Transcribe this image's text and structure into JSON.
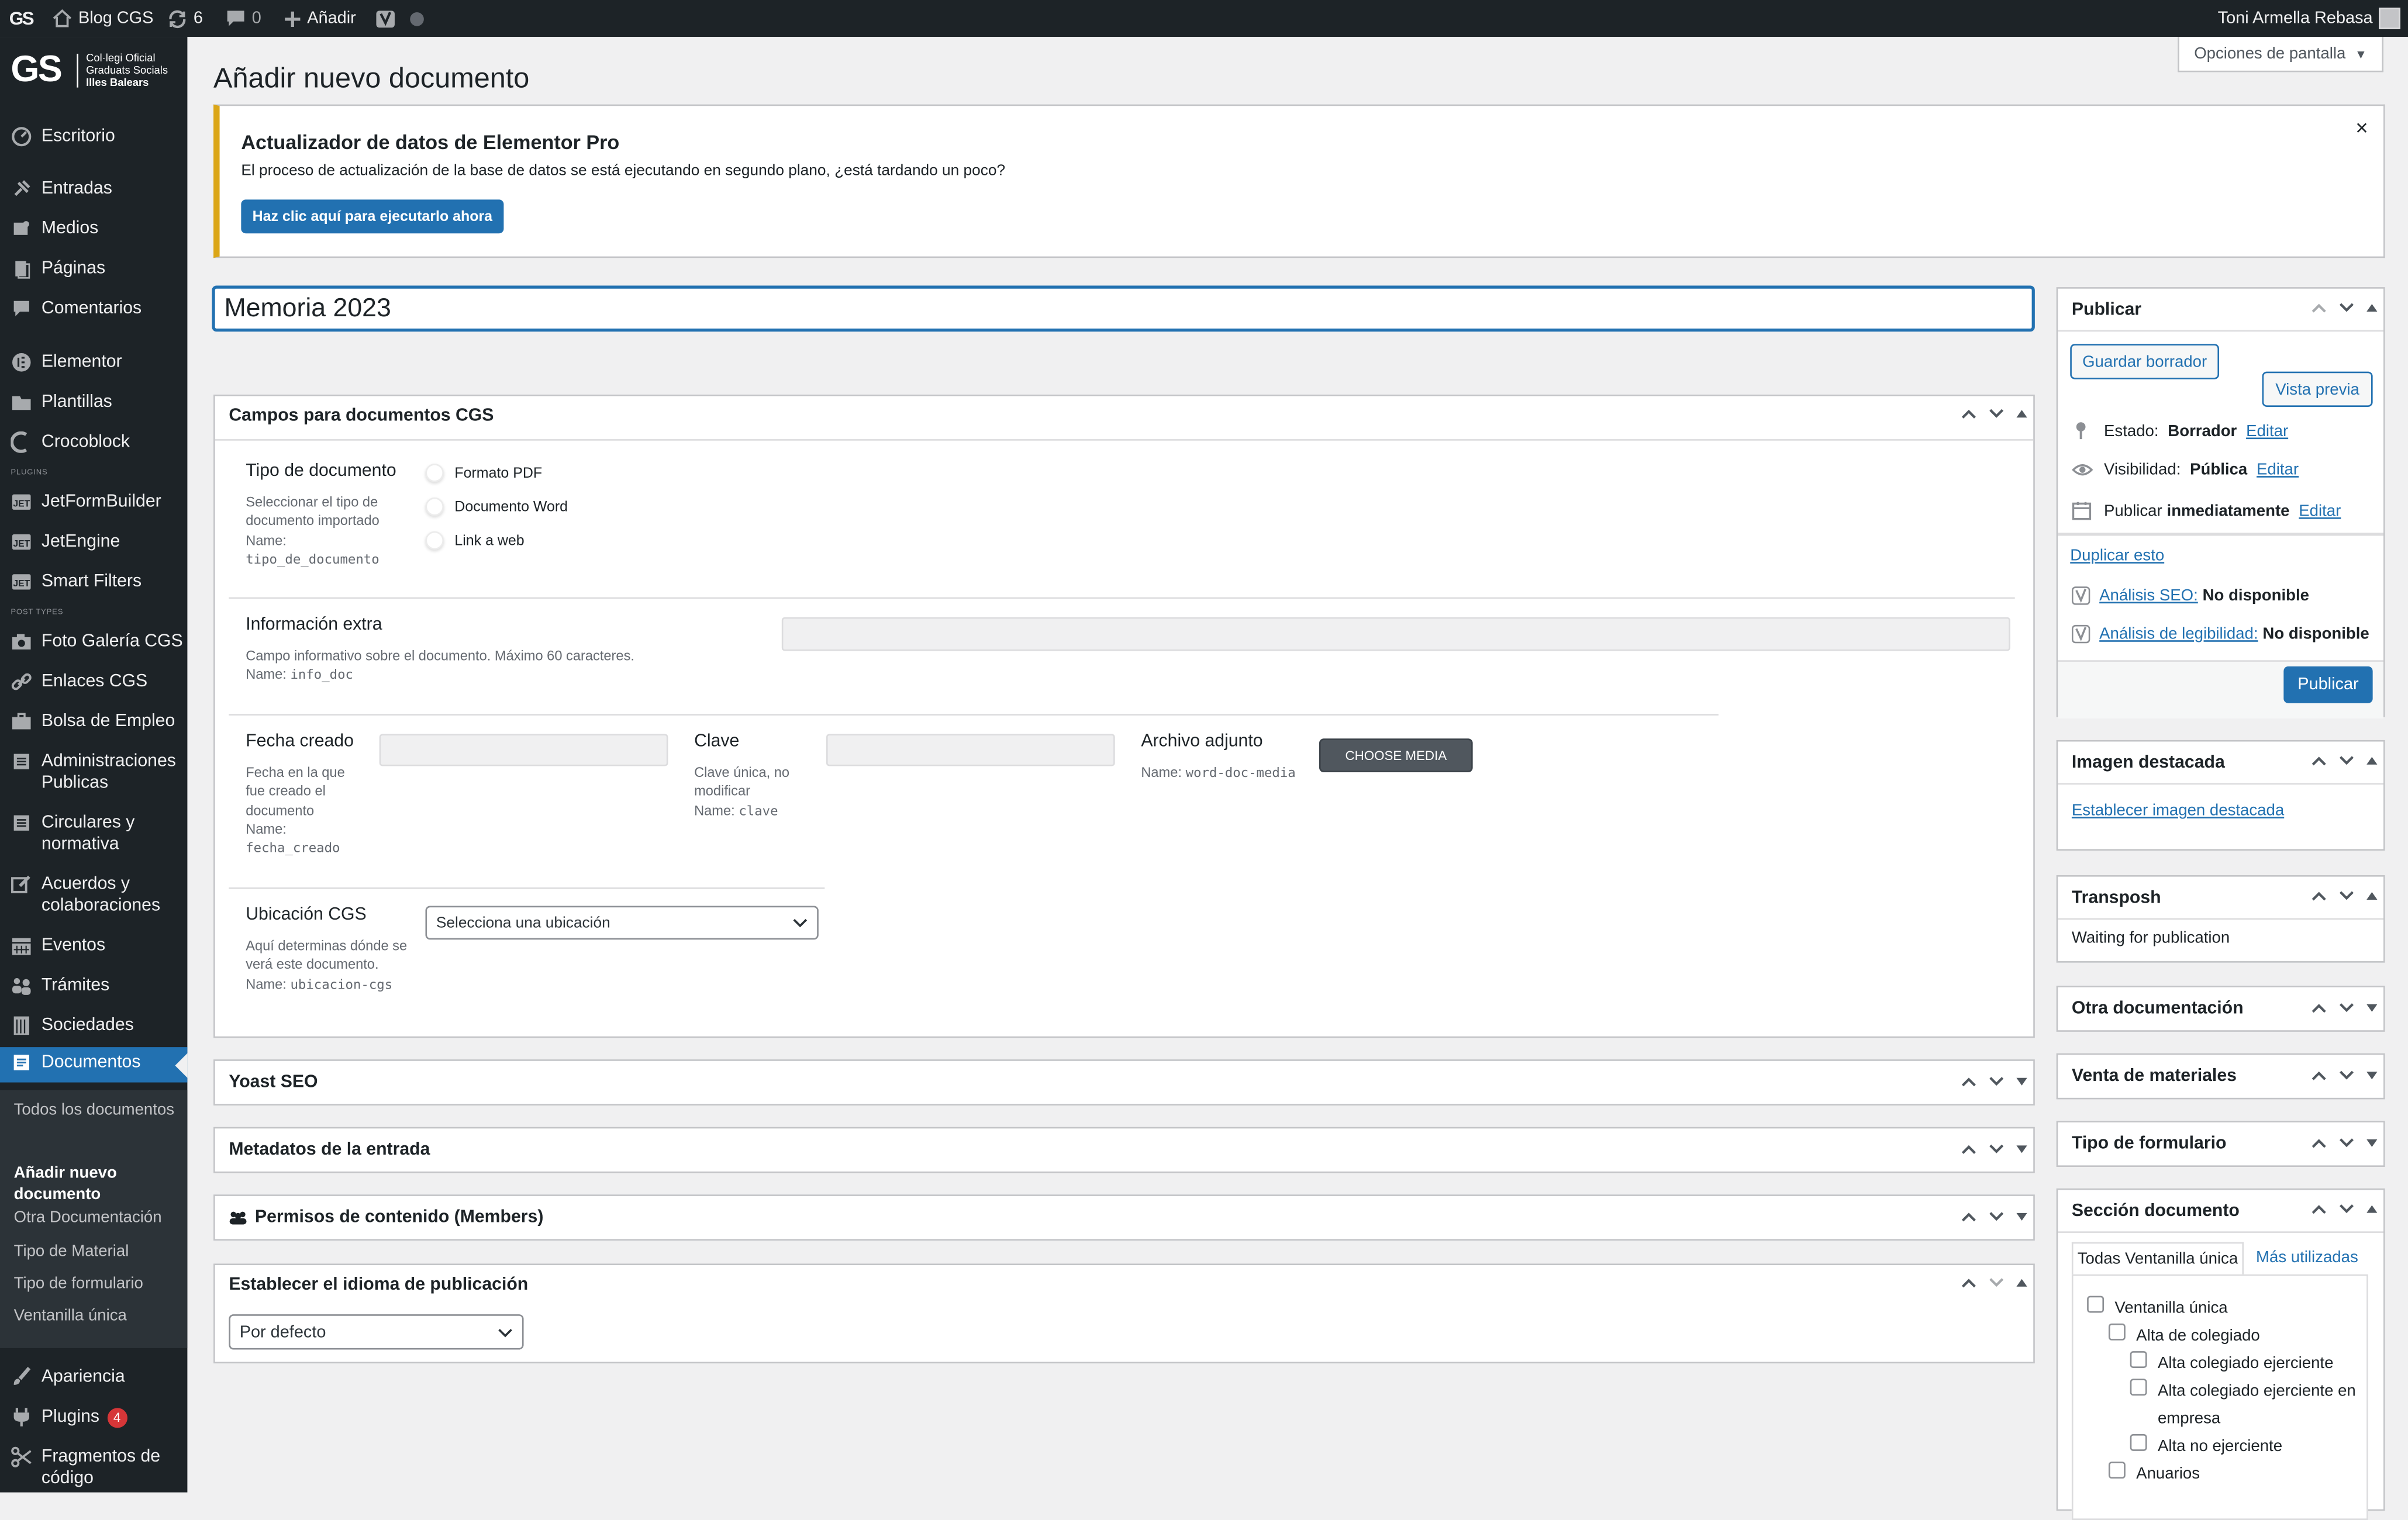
{
  "adminbar": {
    "logo": "GS",
    "site_name": "Blog CGS",
    "updates_count": "6",
    "comments_count": "0",
    "add_label": "Añadir",
    "user_name": "Toni Armella Rebasa"
  },
  "brand": {
    "mark": "GS",
    "line1": "Col·legi Oficial",
    "line2": "Graduats Socials",
    "line3": "Illes Balears"
  },
  "sidebar": {
    "items": [
      {
        "label": "Escritorio",
        "icon": "dashboard-icon"
      },
      {
        "label": "Entradas",
        "icon": "pin-icon"
      },
      {
        "label": "Medios",
        "icon": "media-icon"
      },
      {
        "label": "Páginas",
        "icon": "pages-icon"
      },
      {
        "label": "Comentarios",
        "icon": "comments-icon"
      },
      {
        "label": "Elementor",
        "icon": "elementor-icon"
      },
      {
        "label": "Plantillas",
        "icon": "folder-icon"
      },
      {
        "label": "Crocoblock",
        "icon": "crocoblock-icon"
      },
      {
        "label": "JetFormBuilder",
        "icon": "jet-icon"
      },
      {
        "label": "JetEngine",
        "icon": "jet-icon"
      },
      {
        "label": "Smart Filters",
        "icon": "jet-icon"
      },
      {
        "label": "Foto Galería CGS",
        "icon": "camera-icon"
      },
      {
        "label": "Enlaces CGS",
        "icon": "link-icon"
      },
      {
        "label": "Bolsa de Empleo",
        "icon": "portfolio-icon"
      },
      {
        "label": "Administraciones Publicas",
        "icon": "list-icon"
      },
      {
        "label": "Circulares y normativa",
        "icon": "list-icon"
      },
      {
        "label": "Acuerdos y colaboraciones",
        "icon": "edit-icon"
      },
      {
        "label": "Eventos",
        "icon": "calendar-icon"
      },
      {
        "label": "Trámites",
        "icon": "groups-icon"
      },
      {
        "label": "Sociedades",
        "icon": "building-icon"
      },
      {
        "label": "Documentos",
        "icon": "documents-icon"
      },
      {
        "label": "Apariencia",
        "icon": "brush-icon"
      },
      {
        "label": "Plugins",
        "icon": "plugin-icon",
        "badge": "4"
      },
      {
        "label": "Fragmentos de código",
        "icon": "scissors-icon"
      }
    ],
    "section_plugins": "PLUGINS",
    "section_post_types": "POST TYPES",
    "submenu": [
      {
        "label": "Todos los documentos"
      },
      {
        "label": "Añadir nuevo documento"
      },
      {
        "label": "Otra Documentación"
      },
      {
        "label": "Tipo de Material"
      },
      {
        "label": "Tipo de formulario"
      },
      {
        "label": "Ventanilla única"
      }
    ]
  },
  "screen_options": "Opciones de pantalla",
  "page_title": "Añadir nuevo documento",
  "notice": {
    "title": "Actualizador de datos de Elementor Pro",
    "message": "El proceso de actualización de la base de datos se está ejecutando en segundo plano, ¿está tardando un poco?",
    "button": "Haz clic aquí para ejecutarlo ahora",
    "close": "×"
  },
  "post_title": "Memoria 2023",
  "cgs_box": {
    "title": "Campos para documentos CGS",
    "tipo": {
      "label": "Tipo de documento",
      "help": "Seleccionar el tipo de documento importado",
      "name_prefix": "Name:",
      "name": "tipo_de_documento",
      "options": [
        "Formato PDF",
        "Documento Word",
        "Link a web"
      ]
    },
    "info": {
      "label": "Información extra",
      "help": "Campo informativo sobre el documento. Máximo 60 caracteres.",
      "name_prefix": "Name:",
      "name": "info_doc"
    },
    "fecha": {
      "label": "Fecha creado",
      "help": "Fecha en la que fue creado el documento",
      "name_prefix": "Name:",
      "name": "fecha_creado"
    },
    "clave": {
      "label": "Clave",
      "help": "Clave única, no modificar",
      "name_prefix": "Name:",
      "name": "clave"
    },
    "archivo": {
      "label": "Archivo adjunto",
      "name_prefix": "Name:",
      "name": "word-doc-media",
      "button": "CHOOSE MEDIA"
    },
    "ubicacion": {
      "label": "Ubicación CGS",
      "help": "Aquí determinas dónde se verá este documento.",
      "name_prefix": "Name:",
      "name": "ubicacion-cgs",
      "selected": "Selecciona una ubicación"
    }
  },
  "collapsed_boxes": [
    "Yoast SEO",
    "Metadatos de la entrada",
    "Permisos de contenido (Members)"
  ],
  "language_box": {
    "title": "Establecer el idioma de publicación",
    "selected": "Por defecto"
  },
  "publish_box": {
    "title": "Publicar",
    "save_draft": "Guardar borrador",
    "preview": "Vista previa",
    "status_label": "Estado:",
    "status_value": "Borrador",
    "visibility_label": "Visibilidad:",
    "visibility_value": "Pública",
    "publish_label": "Publicar",
    "publish_value": "inmediatamente",
    "edit": "Editar",
    "duplicate": "Duplicar esto",
    "seo_label": "Análisis SEO:",
    "seo_value": "No disponible",
    "read_label": "Análisis de legibilidad:",
    "read_value": "No disponible",
    "publish_button": "Publicar"
  },
  "featured_box": {
    "title": "Imagen destacada",
    "link": "Establecer imagen destacada"
  },
  "transposh_box": {
    "title": "Transposh",
    "text": "Waiting for publication"
  },
  "side_collapsed": [
    "Otra documentación",
    "Venta de materiales",
    "Tipo de formulario"
  ],
  "section_box": {
    "title": "Sección documento",
    "tab_all": "Todas Ventanilla única",
    "tab_used": "Más utilizadas",
    "terms": [
      {
        "label": "Ventanilla única",
        "level": 0
      },
      {
        "label": "Alta de colegiado",
        "level": 1
      },
      {
        "label": "Alta colegiado ejerciente",
        "level": 2
      },
      {
        "label": "Alta colegiado ejerciente en empresa",
        "level": 2
      },
      {
        "label": "Alta no ejerciente",
        "level": 2
      },
      {
        "label": "Anuarios",
        "level": 1
      }
    ]
  },
  "colors": {
    "adminbar_bg": "#1d2327",
    "accent": "#2271b1",
    "notice_border": "#dba617",
    "badge": "#d63638"
  }
}
